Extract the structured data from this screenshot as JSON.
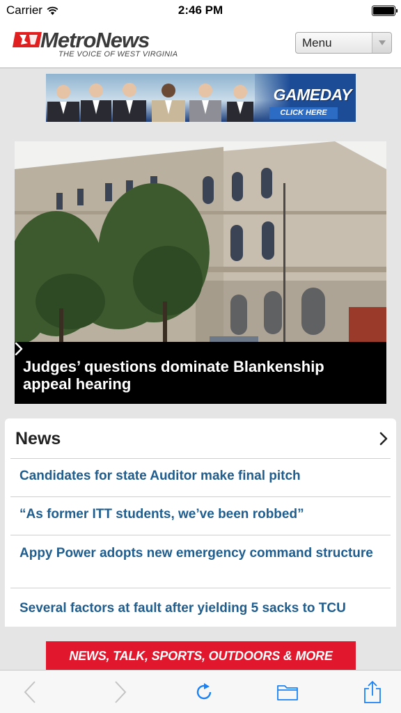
{
  "status_bar": {
    "carrier": "Carrier",
    "time": "2:46 PM",
    "battery_level": 1.0
  },
  "header": {
    "logo_name": "MetroNews",
    "logo_tagline": "THE VOICE OF WEST VIRGINIA",
    "menu_label": "Menu",
    "colors": {
      "logo_red": "#e02020",
      "logo_text": "#3a3a3a"
    }
  },
  "ad_banner": {
    "title": "GAMEDAY",
    "cta": "CLICK HERE"
  },
  "hero": {
    "headline": "Judges’ questions dominate Blankenship appeal hearing",
    "icon": "chevron-right-icon"
  },
  "news": {
    "section_title": "News",
    "items": [
      "Candidates for state Auditor make final pitch",
      "“As former ITT students, we’ve been robbed”",
      "Appy Power adopts new emergency command structure",
      "Several factors at fault after yielding 5 sacks to TCU"
    ],
    "colors": {
      "link": "#1f5d8e"
    }
  },
  "footer_banner": {
    "text": "NEWS, TALK, SPORTS, OUTDOORS & MORE",
    "color": "#e1182d"
  },
  "toolbar": {
    "icons": [
      "back-icon",
      "forward-icon",
      "reload-icon",
      "bookmarks-icon",
      "share-icon"
    ],
    "accent": "#1a82f7"
  }
}
